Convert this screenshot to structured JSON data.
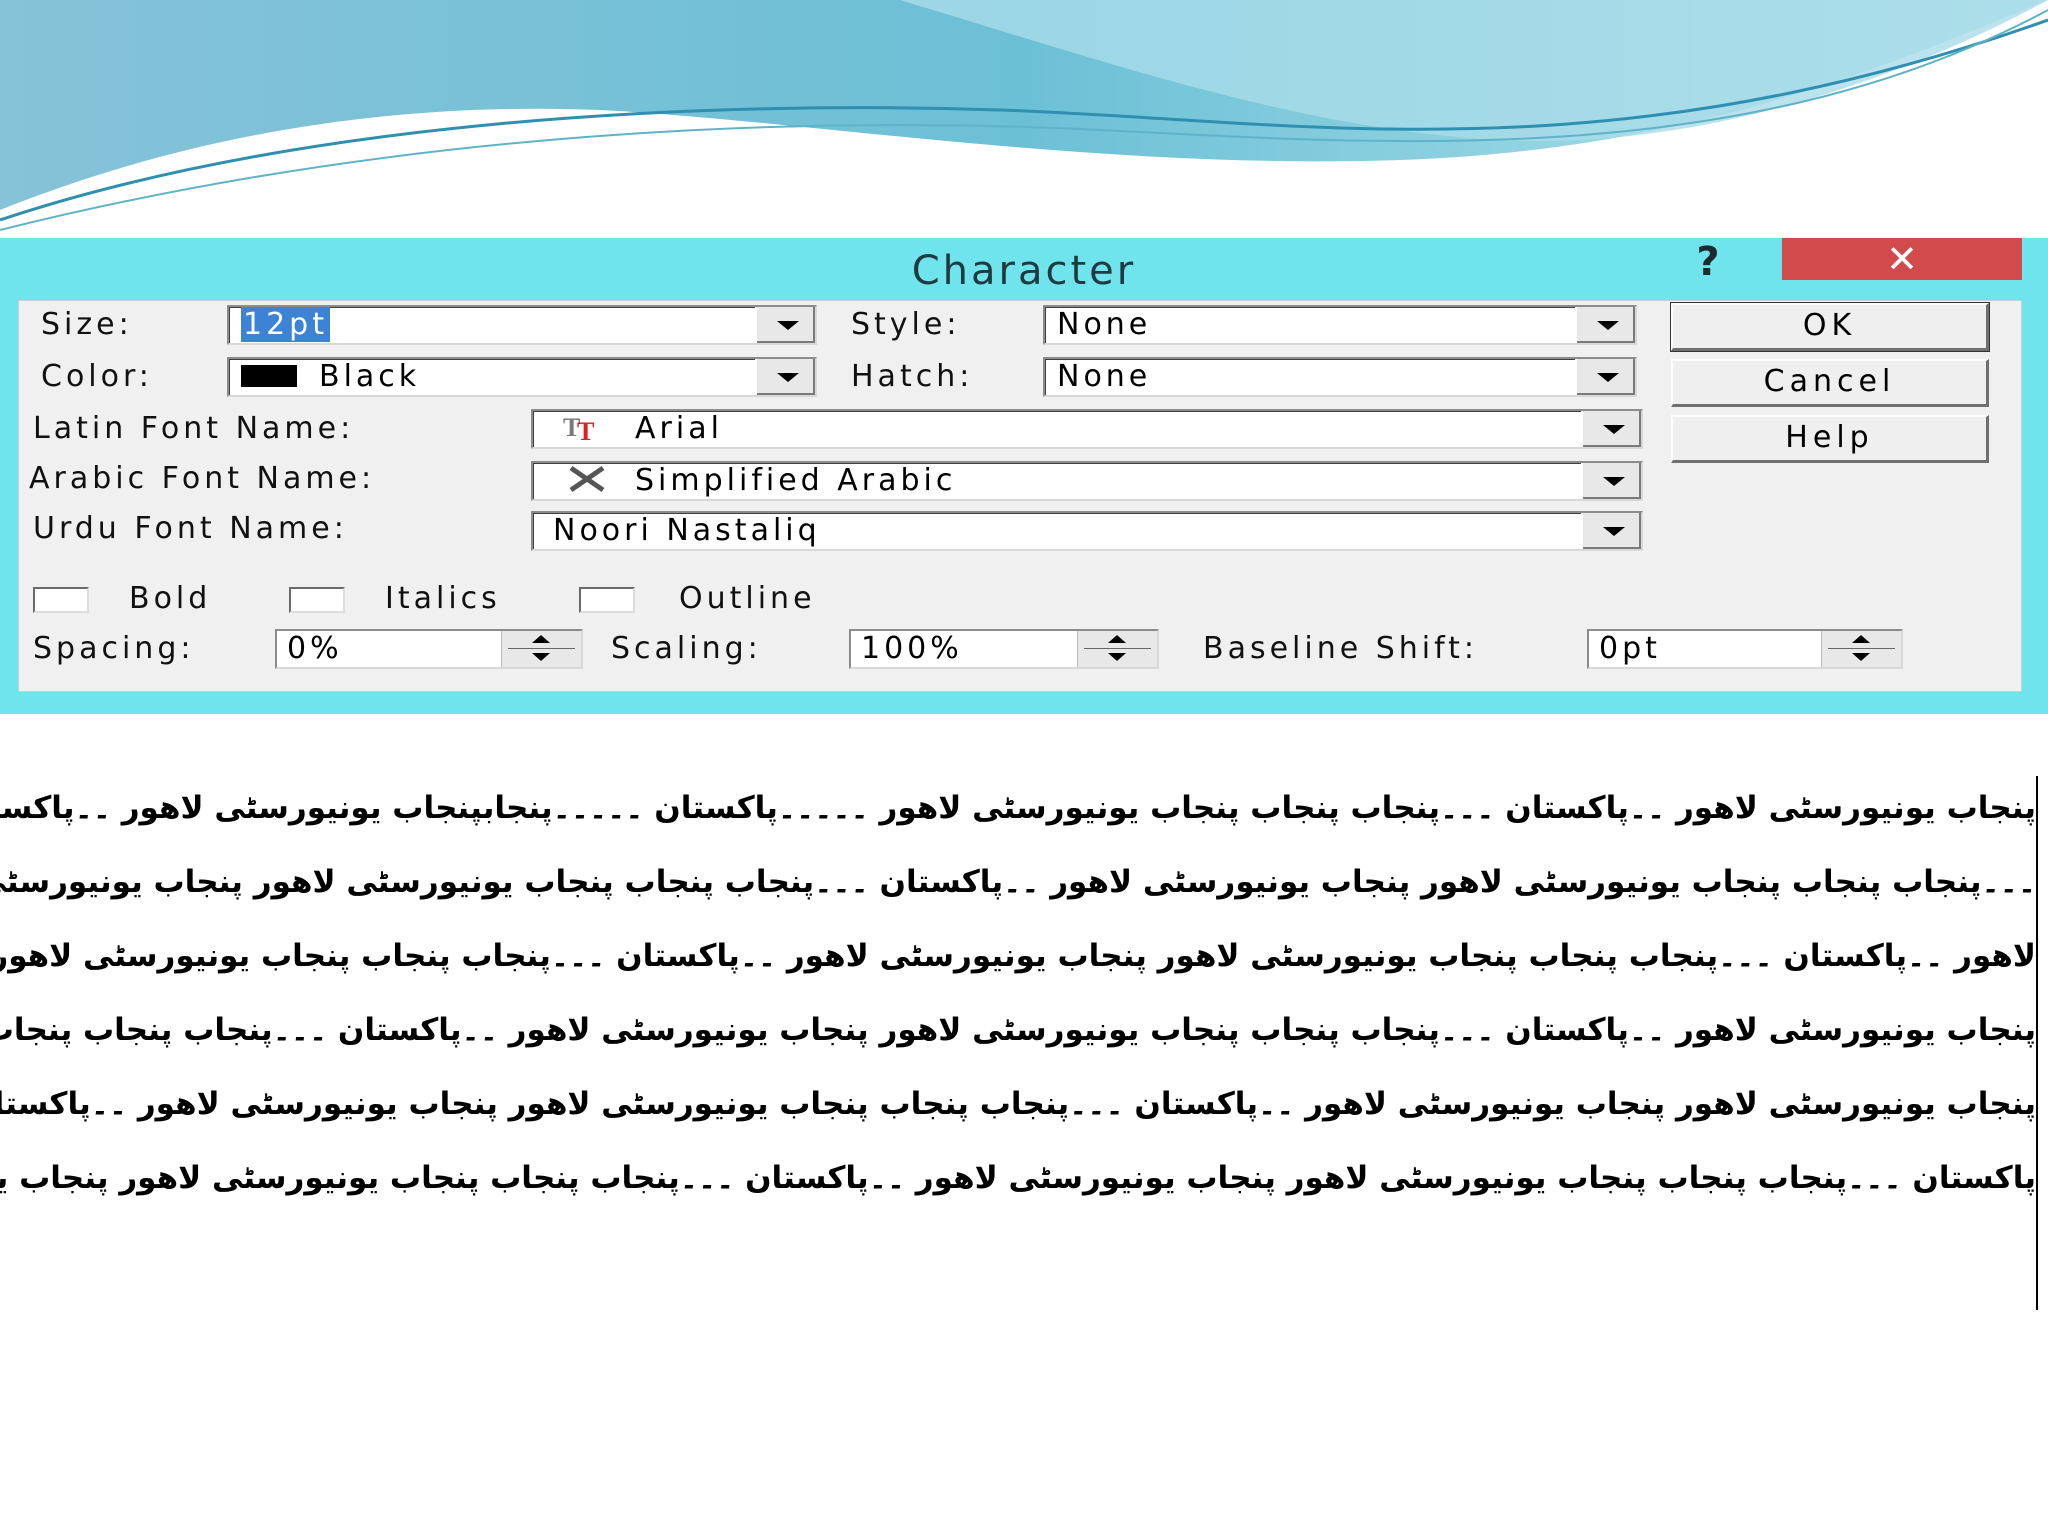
{
  "dialog": {
    "title": "Character",
    "help_icon": "question-mark-icon",
    "close_icon": "close-x-icon",
    "close_color": "#d14b4d",
    "title_bar_color": "#6fe4ec",
    "labels": {
      "size": "Size:",
      "color": "Color:",
      "style": "Style:",
      "hatch": "Hatch:",
      "latin_font": "Latin Font Name:",
      "arabic_font": "Arabic Font Name:",
      "urdu_font": "Urdu Font Name:",
      "spacing": "Spacing:",
      "scaling": "Scaling:",
      "baseline_shift": "Baseline Shift:"
    },
    "values": {
      "size": "12pt",
      "color": "Black",
      "style": "None",
      "hatch": "None",
      "latin_font": "Arial",
      "arabic_font": "Simplified Arabic",
      "urdu_font": "Noori Nastaliq",
      "spacing": "0%",
      "scaling": "100%",
      "baseline_shift": "0pt"
    },
    "checkboxes": {
      "bold": "Bold",
      "italics": "Italics",
      "outline": "Outline"
    },
    "buttons": {
      "ok": "OK",
      "cancel": "Cancel",
      "help": "Help"
    }
  },
  "urdu_text": {
    "lines": [
      "پنجاب یونیورسٹی لاهور ۔۔پاکستان ۔۔۔پنجاب پنجاب پنجاب یونیورسٹی لاهور ۔۔۔۔۔پاکستان ۔۔۔۔۔پنجابپنجاب یونیورسٹی لاهور ۔۔پاکستان ۔۔۔۔۔پنجابپنجاب یونیورسٹی لاهور ۔۔پاکستان",
      "۔۔۔پنجاب پنجاب پنجاب یونیورسٹی لاهور پنجاب یونیورسٹی لاهور ۔۔پاکستان ۔۔۔پنجاب پنجاب پنجاب یونیورسٹی لاهور پنجاب یونیورسٹی لاهور ۔۔پاکستان ۔۔۔پنجاب پنجاب پنجاب یونیورسٹی لاهور پنجاب یونیورسٹی",
      "لاهور ۔۔پاکستان ۔۔۔پنجاب پنجاب پنجاب یونیورسٹی لاهور پنجاب یونیورسٹی لاهور ۔۔پاکستان ۔۔۔پنجاب پنجاب پنجاب یونیورسٹی لاهور پنجاب یونیورسٹی لاهور ۔۔پاکستان ۔۔۔پنجاب پنجاب پنجاب یونیورسٹی لاهور",
      "پنجاب یونیورسٹی لاهور ۔۔پاکستان ۔۔۔پنجاب پنجاب پنجاب یونیورسٹی لاهور پنجاب یونیورسٹی لاهور ۔۔پاکستان ۔۔۔پنجاب پنجاب پنجاب یونیورسٹی لاهور پنجاب یونیورسٹی لاهور ۔۔پاکستان ۔۔۔پنجاب",
      "پنجاب یونیورسٹی لاهور پنجاب یونیورسٹی لاهور ۔۔پاکستان ۔۔۔پنجاب پنجاب پنجاب یونیورسٹی لاهور پنجاب یونیورسٹی لاهور ۔۔پاکستان ۔۔۔پنجاب پنجاب پنجاب یونیورسٹی لاهور پنجاب یونیورسٹی لاهور ۔۔",
      "پاکستان ۔۔۔پنجاب پنجاب پنجاب یونیورسٹی لاهور پنجاب یونیورسٹی لاهور ۔۔پاکستان ۔۔۔پنجاب پنجاب پنجاب یونیورسٹی لاهور پنجاب یونیورسٹی لاهور ۔۔پاکستان ۔۔۔پنجاب پنجاب پنجاب یونیورسٹی لاهور"
    ]
  }
}
